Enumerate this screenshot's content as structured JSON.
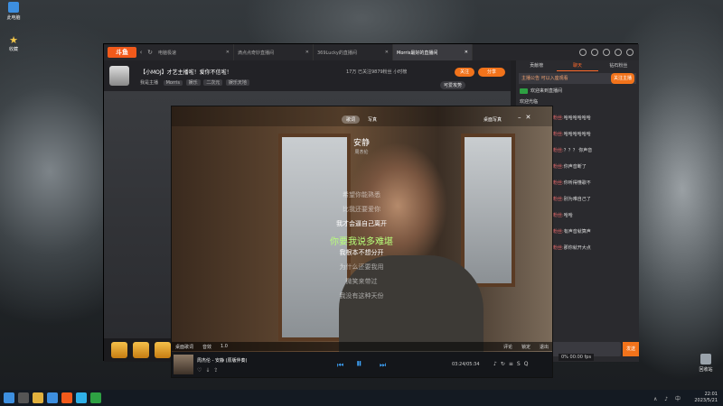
{
  "desktop": {
    "icons": [
      {
        "label": "此电脑",
        "icon": "computer-icon"
      },
      {
        "label": "收藏",
        "icon": "star-icon"
      },
      {
        "label": "回收站",
        "icon": "recycle-bin-icon"
      }
    ]
  },
  "browser": {
    "logo": "斗鱼",
    "tabs": [
      {
        "label": "电脑极速",
        "close": "✕"
      },
      {
        "label": "滴点点奇妙直播间",
        "close": "✕"
      },
      {
        "label": "369Lucky的直播间",
        "close": "✕"
      },
      {
        "label": "Morris最好的直播间",
        "close": "✕"
      }
    ],
    "stream": {
      "title": "【小MOJ】才艺主播啦！爱你不信啦！",
      "anchor_name": "我是主播",
      "tags": [
        "Morris",
        "娱乐",
        "二次元",
        "娱乐天地"
      ],
      "stats": "17万  已关注9879粉丝  小时榜",
      "follow_label": "关注",
      "share_label": "分享",
      "rank_label": "可爱攻势"
    },
    "chat": {
      "tabs": [
        "贡献榜",
        "聊天",
        "钻石粉丝"
      ],
      "notice": "主播公告 可以入座观看",
      "notice_action": "关注主播",
      "system_lines": [
        "欢迎来到直播间",
        "欢迎光临"
      ],
      "messages": [
        {
          "level": "3",
          "user": "我是你的小粉丝:",
          "text": "哈哈哈哈哈哈"
        },
        {
          "level": "3",
          "user": "我是你的小粉丝:",
          "text": "哈哈哈哈哈哈"
        },
        {
          "level": "3",
          "user": "我是你的小粉丝:",
          "text": "？？？ 你声音"
        },
        {
          "level": "3",
          "user": "我是你的小粉丝:",
          "text": "你声音断了"
        },
        {
          "level": "3",
          "user": "我是你的小粉丝:",
          "text": "你听得懂歌不"
        },
        {
          "level": "3",
          "user": "我是你的小粉丝:",
          "text": "别为难自己了"
        },
        {
          "level": "3",
          "user": "我是你的小粉丝:",
          "text": "哈哈"
        },
        {
          "level": "3",
          "user": "我是你的小粉丝:",
          "text": "有声音就算声"
        },
        {
          "level": "3",
          "user": "我是你的小粉丝:",
          "text": "那你就开大点"
        }
      ],
      "input_placeholder": "点击发送内容",
      "send_label": "发送"
    },
    "sysinfo": "0% 00:00 fps"
  },
  "player": {
    "tabs": [
      "歌词",
      "写真"
    ],
    "top_right": "桌面写真",
    "song": "安静",
    "artist": "周杰伦",
    "lyrics": [
      "希望你能熟悉",
      "比我还要爱你",
      "我才会逼自己离开",
      "你要我说多难堪",
      "我根本不想分开",
      "为什么还要我用",
      "微笑来带过",
      "我没有这种天份"
    ],
    "current_index": 3,
    "toolbar": {
      "desktop_lyrics": "桌面歌词",
      "fx": "音效",
      "speed": "1.0",
      "comment": "评论",
      "exit": "退出",
      "lock": "锁定"
    },
    "now_playing": "周杰伦 - 安静 (原版伴奏)",
    "time": "03:24/05:34",
    "quality": "SQ"
  },
  "taskbar": {
    "time": "22:01",
    "date": "2023/5/21",
    "tray": "∧ ♪ 中"
  }
}
